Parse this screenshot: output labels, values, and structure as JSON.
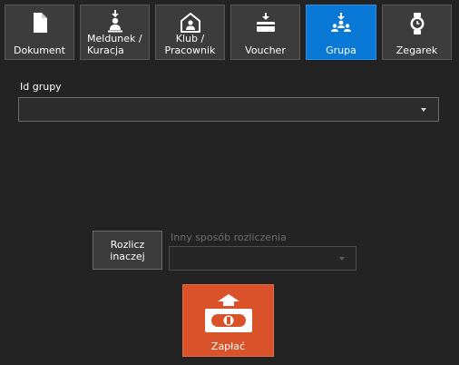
{
  "tabs": [
    {
      "id": "dokument",
      "label": "Dokument",
      "icon": "document-icon",
      "active": false
    },
    {
      "id": "meldunek",
      "label": "Meldunek /\nKuracja",
      "icon": "person-checkin-icon",
      "active": false
    },
    {
      "id": "klub",
      "label": "Klub /\nPracownik",
      "icon": "home-person-icon",
      "active": false
    },
    {
      "id": "voucher",
      "label": "Voucher",
      "icon": "voucher-icon",
      "active": false
    },
    {
      "id": "grupa",
      "label": "Grupa",
      "icon": "group-icon",
      "active": true
    },
    {
      "id": "zegarek",
      "label": "Zegarek",
      "icon": "watch-icon",
      "active": false
    }
  ],
  "group_id": {
    "label": "Id grupy",
    "value": ""
  },
  "settle": {
    "button_label": "Rozlicz\ninaczej",
    "other_method_label": "Inny sposób rozliczenia",
    "other_method_value": ""
  },
  "pay": {
    "label": "Zapłać",
    "icon": "cash-payment-icon"
  },
  "colors": {
    "background": "#232323",
    "tab": "#3c3c3c",
    "active_tab": "#0a78d7",
    "pay_button": "#d9522a"
  }
}
